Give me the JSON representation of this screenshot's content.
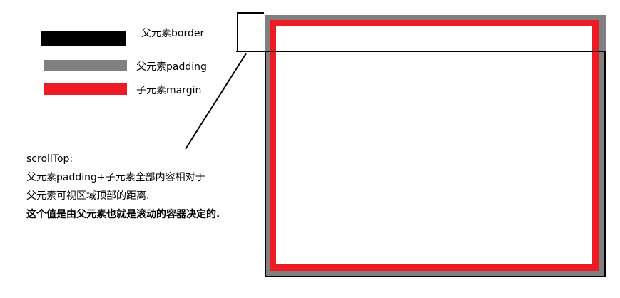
{
  "legend": {
    "items": [
      {
        "label": "父元素border",
        "color": "#000000"
      },
      {
        "label": "父元素padding",
        "color": "#808080"
      },
      {
        "label": "子元素margin",
        "color": "#ed1c24"
      }
    ]
  },
  "note": {
    "title": "scrollTop:",
    "line1": "父元素padding+子元素全部内容相对于",
    "line2": "父元素可视区域顶部的距离.",
    "emphasis": "这个值是由父元素也就是滚动的容器决定的."
  }
}
